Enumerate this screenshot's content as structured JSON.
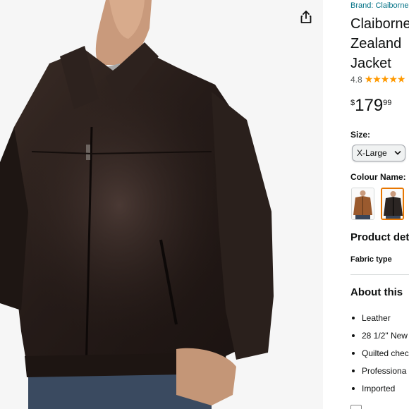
{
  "product": {
    "brand_link": "Brand: Claiborne",
    "title_lines": [
      "Claiborne",
      "Zealand",
      "Jacket"
    ],
    "rating_value": "4.8",
    "stars": "★★★★★",
    "price": {
      "symbol": "$",
      "whole": "179",
      "fraction": "99"
    }
  },
  "size": {
    "label": "Size:",
    "selected": "X-Large"
  },
  "colour": {
    "label": "Colour Name:",
    "swatches": [
      {
        "name": "brown-swatch",
        "selected": false,
        "color": "#9a5a2e"
      },
      {
        "name": "black-swatch",
        "selected": true,
        "color": "#2b2523"
      }
    ]
  },
  "details": {
    "heading": "Product det",
    "fabric_type_label": "Fabric type"
  },
  "about": {
    "heading": "About this",
    "bullets": [
      "Leather",
      "28 1/2\" New",
      "Quilted chec",
      "Professiona",
      "Imported"
    ]
  },
  "colors": {
    "link": "#007185",
    "star": "#ff9900",
    "selected_border": "#e77600"
  },
  "icons": {
    "share": "share-icon",
    "dropdown": "chevron-down-icon"
  }
}
